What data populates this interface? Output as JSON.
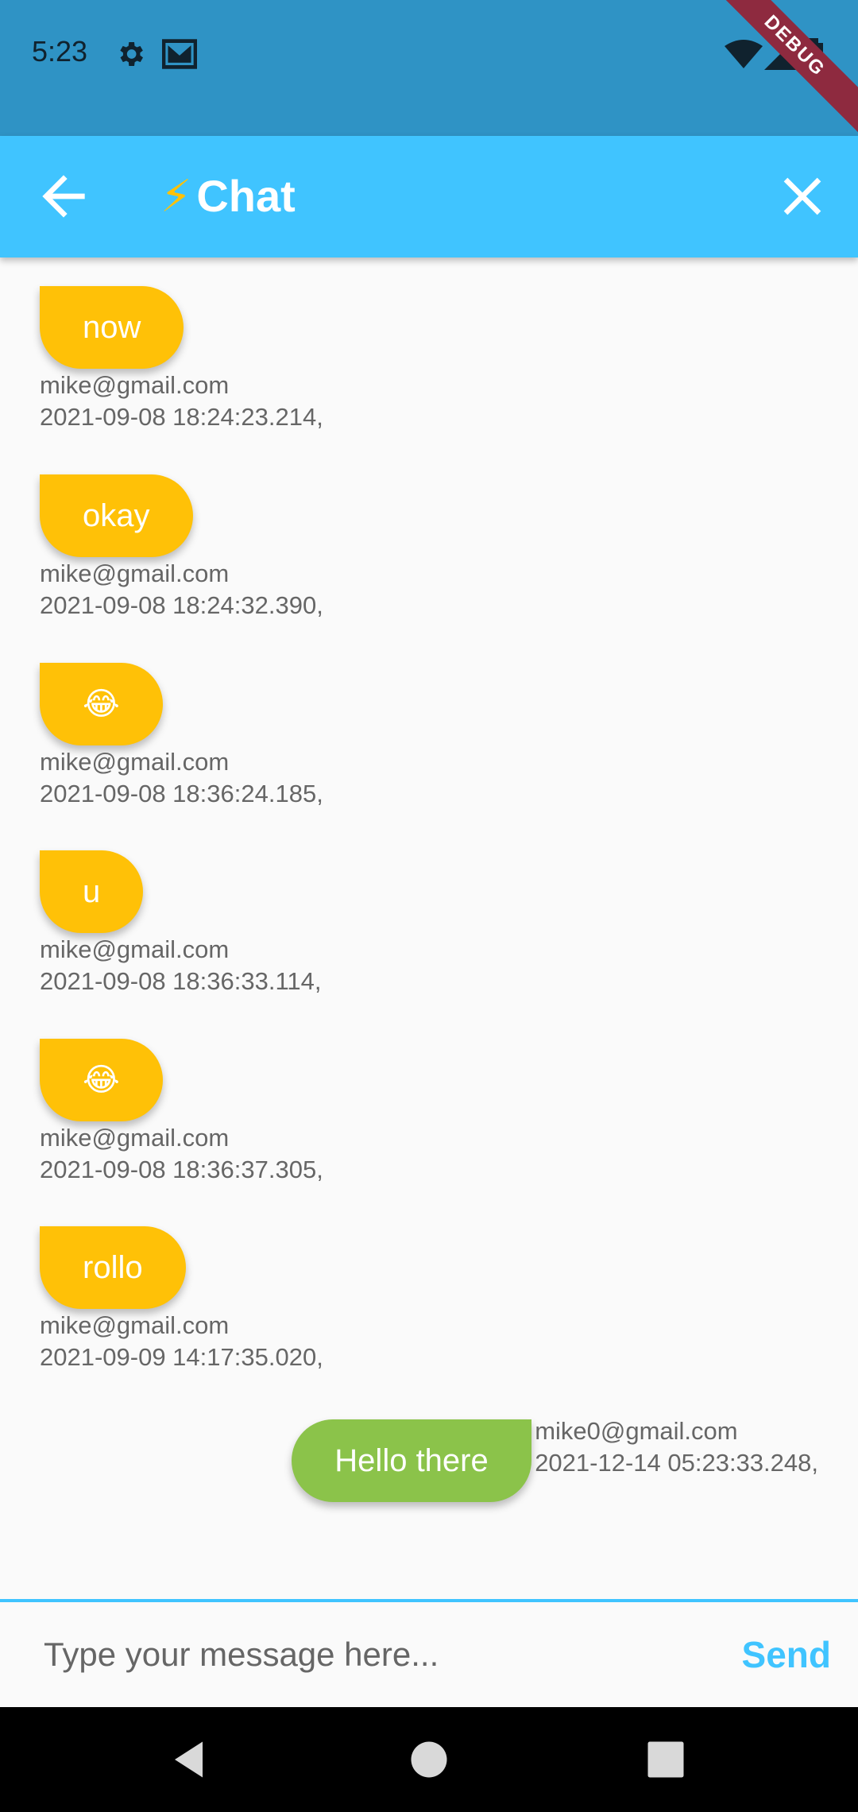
{
  "status_bar": {
    "time": "5:23",
    "left_icons": [
      "gear-icon",
      "mail-icon"
    ],
    "right_icons": [
      "wifi-icon",
      "signal-icon",
      "battery-icon"
    ],
    "debug_label": "DEBUG"
  },
  "app_bar": {
    "title_emoji": "⚡",
    "title": "Chat",
    "back_icon": "arrow-back-icon",
    "close_icon": "close-icon",
    "color": "#40c4ff"
  },
  "messages": [
    {
      "text": "now",
      "sender": "mike@gmail.com",
      "timestamp": "2021-09-08 18:24:23.214,",
      "side": "left"
    },
    {
      "text": "okay",
      "sender": "mike@gmail.com",
      "timestamp": "2021-09-08 18:24:32.390,",
      "side": "left"
    },
    {
      "text": "😂",
      "sender": "mike@gmail.com",
      "timestamp": "2021-09-08 18:36:24.185,",
      "side": "left"
    },
    {
      "text": "u",
      "sender": "mike@gmail.com",
      "timestamp": "2021-09-08 18:36:33.114,",
      "side": "left"
    },
    {
      "text": "😂",
      "sender": "mike@gmail.com",
      "timestamp": "2021-09-08 18:36:37.305,",
      "side": "left"
    },
    {
      "text": "rollo",
      "sender": "mike@gmail.com",
      "timestamp": "2021-09-09 14:17:35.020,",
      "side": "left"
    },
    {
      "text": "Hello there",
      "sender": "mike0@gmail.com",
      "timestamp": "2021-12-14 05:23:33.248,",
      "side": "right"
    }
  ],
  "colors": {
    "received_bubble": "#ffc107",
    "sent_bubble": "#8bc34a",
    "accent": "#40c4ff"
  },
  "input": {
    "placeholder": "Type your message here...",
    "value": "",
    "send_label": "Send"
  },
  "nav_bar": {
    "icons": [
      "nav-back-icon",
      "nav-home-icon",
      "nav-recents-icon"
    ]
  }
}
